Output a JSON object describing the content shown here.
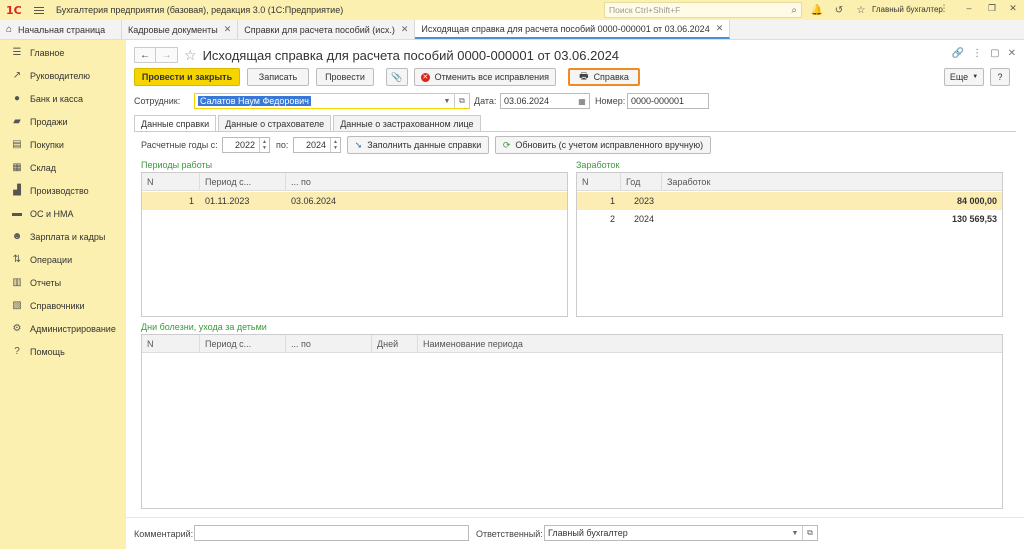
{
  "app": {
    "logo": "1С",
    "title": "Бухгалтерия предприятия (базовая), редакция 3.0  (1С:Предприятие)",
    "search_placeholder": "Поиск Ctrl+Shift+F",
    "user": "Главный бухгалтер"
  },
  "tabs": [
    {
      "label": "Начальная страница"
    },
    {
      "label": "Кадровые документы"
    },
    {
      "label": "Справки для расчета пособий (исх.)"
    },
    {
      "label": "Исходящая справка для расчета пособий 0000-000001 от 03.06.2024"
    }
  ],
  "sidebar": {
    "items": [
      {
        "label": "Главное",
        "icon": "list-icon"
      },
      {
        "label": "Руководителю",
        "icon": "trend-icon"
      },
      {
        "label": "Банк и касса",
        "icon": "coin-icon"
      },
      {
        "label": "Продажи",
        "icon": "bag-icon"
      },
      {
        "label": "Покупки",
        "icon": "cart-icon"
      },
      {
        "label": "Склад",
        "icon": "warehouse-icon"
      },
      {
        "label": "Производство",
        "icon": "factory-icon"
      },
      {
        "label": "ОС и НМА",
        "icon": "truck-icon"
      },
      {
        "label": "Зарплата и кадры",
        "icon": "people-icon"
      },
      {
        "label": "Операции",
        "icon": "operations-icon"
      },
      {
        "label": "Отчеты",
        "icon": "chart-icon"
      },
      {
        "label": "Справочники",
        "icon": "books-icon"
      },
      {
        "label": "Администрирование",
        "icon": "gear-icon"
      },
      {
        "label": "Помощь",
        "icon": "question-icon"
      }
    ]
  },
  "doc": {
    "title": "Исходящая справка для расчета пособий 0000-000001 от 03.06.2024"
  },
  "toolbar": {
    "post_close": "Провести и закрыть",
    "save": "Записать",
    "post": "Провести",
    "cancel_fixes": "Отменить все исправления",
    "certificate": "Справка",
    "more": "Еще",
    "help": "?"
  },
  "form": {
    "employee_label": "Сотрудник:",
    "employee_value": "Салатов Наум Федорович",
    "date_label": "Дата:",
    "date_value": "03.06.2024",
    "number_label": "Номер:",
    "number_value": "0000-000001"
  },
  "form_tabs": [
    {
      "label": "Данные справки"
    },
    {
      "label": "Данные о страхователе"
    },
    {
      "label": "Данные о застрахованном лице"
    }
  ],
  "years": {
    "label_from": "Расчетные годы с:",
    "from": "2022",
    "label_to": "по:",
    "to": "2024",
    "fill_btn": "Заполнить данные справки",
    "refresh_btn": "Обновить (с учетом исправленного вручную)"
  },
  "work_periods": {
    "title": "Периоды работы",
    "columns": [
      "N",
      "Период с...",
      "... по"
    ],
    "rows": [
      {
        "n": "1",
        "from": "01.11.2023",
        "to": "03.06.2024"
      }
    ]
  },
  "earnings": {
    "title": "Заработок",
    "columns": [
      "N",
      "Год",
      "Заработок"
    ],
    "rows": [
      {
        "n": "1",
        "year": "2023",
        "amount": "84 000,00"
      },
      {
        "n": "2",
        "year": "2024",
        "amount": "130 569,53"
      }
    ]
  },
  "sick_days": {
    "title": "Дни болезни, ухода за детьми",
    "columns": [
      "N",
      "Период с...",
      "... по",
      "Дней",
      "Наименование периода"
    ]
  },
  "footer": {
    "comment_label": "Комментарий:",
    "comment_value": "",
    "responsible_label": "Ответственный:",
    "responsible_value": "Главный бухгалтер"
  }
}
